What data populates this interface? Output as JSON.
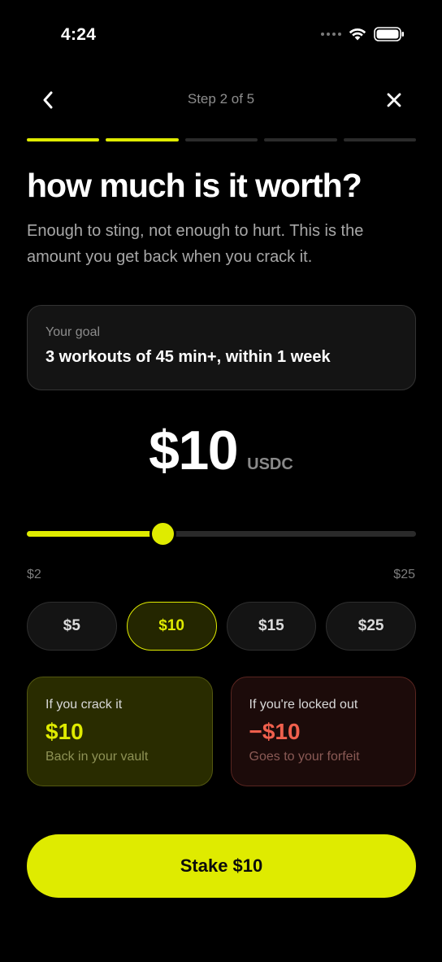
{
  "status_bar": {
    "time": "4:24"
  },
  "nav": {
    "step_label": "Step 2 of 5"
  },
  "progress": {
    "total_steps": 5,
    "completed_steps": 2
  },
  "header": {
    "title": "how much is it worth?",
    "subtitle": "Enough to sting, not enough to hurt. This is the amount you get back when you crack it."
  },
  "goal": {
    "label": "Your goal",
    "text": "3 workouts of 45 min+, within 1 week"
  },
  "amount": {
    "value": "$10",
    "unit": "USDC"
  },
  "slider": {
    "min": 2,
    "max": 25,
    "value": 10,
    "min_label": "$2",
    "max_label": "$25"
  },
  "presets": [
    {
      "label": "$5",
      "selected": false
    },
    {
      "label": "$10",
      "selected": true
    },
    {
      "label": "$15",
      "selected": false
    },
    {
      "label": "$25",
      "selected": false
    }
  ],
  "outcomes": {
    "win": {
      "label": "If you crack it",
      "amount": "$10",
      "note": "Back in your vault"
    },
    "lose": {
      "label": "If you're locked out",
      "amount": "−$10",
      "note": "Goes to your forfeit"
    }
  },
  "cta": {
    "label": "Stake $10"
  },
  "colors": {
    "accent": "#dfeb00",
    "danger": "#f0604d",
    "background": "#000000"
  },
  "icons": {
    "back": "chevron-left-icon",
    "close": "close-icon",
    "wifi": "wifi-icon",
    "battery": "battery-icon",
    "signal": "signal-icon"
  }
}
